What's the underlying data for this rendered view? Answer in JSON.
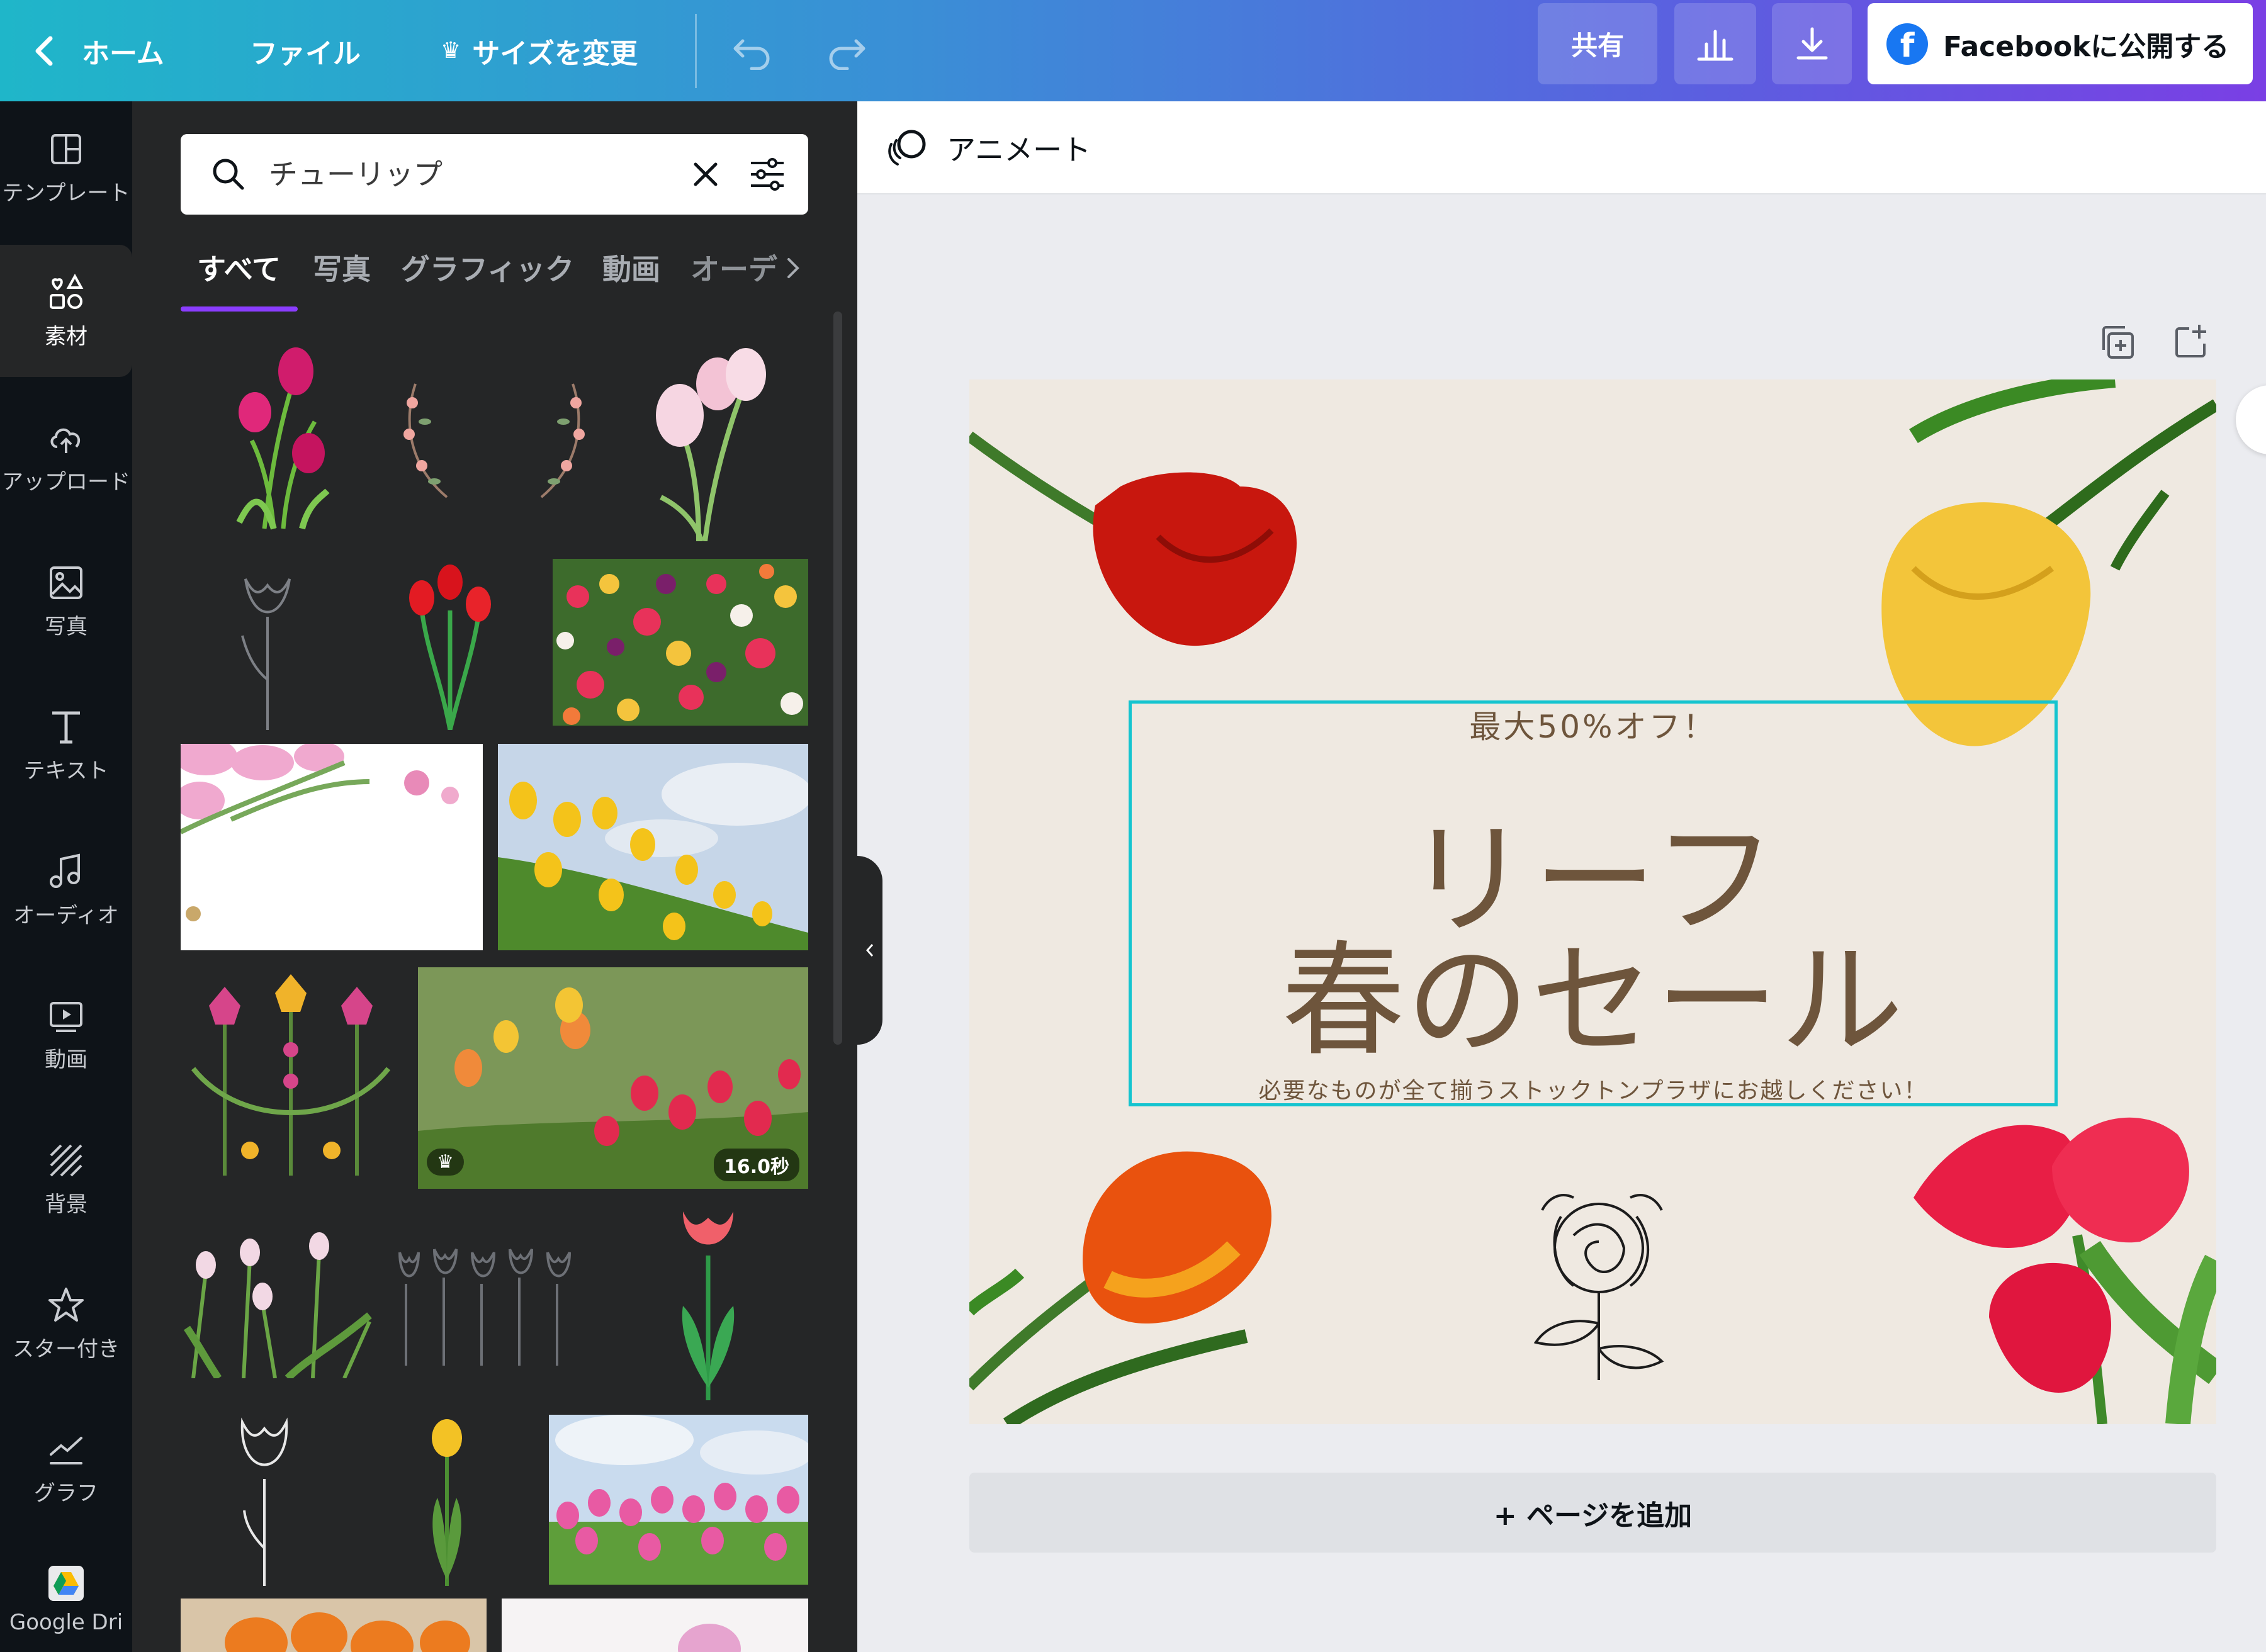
{
  "topbar": {
    "home": "ホーム",
    "file": "ファイル",
    "resize": "サイズを変更",
    "share": "共有",
    "publish": "Facebookに公開する"
  },
  "nav": {
    "templates": "テンプレート",
    "elements": "素材",
    "uploads": "アップロード",
    "photos": "写真",
    "text": "テキスト",
    "audio": "オーディオ",
    "video": "動画",
    "background": "背景",
    "starred": "スター付き",
    "chart": "グラフ",
    "gdrive": "Google Dri"
  },
  "search": {
    "value": "チューリップ"
  },
  "tabs": {
    "all": "すべて",
    "photos": "写真",
    "graphics": "グラフィック",
    "video": "動画",
    "audio": "オーデ"
  },
  "results": {
    "video_duration": "16.0秒"
  },
  "canvas": {
    "animate": "アニメート",
    "small": "最大50%オフ！",
    "title_line1": "リーフ",
    "title_line2": "春のセール",
    "footer": "必要なものが全て揃うストックトンプラザにお越しください！",
    "add_page": "+ ページを追加"
  },
  "colors": {
    "accent": "#8b3dff",
    "selection": "#14c4cf",
    "design_bg": "#efe9e1",
    "design_text": "#6e553c"
  }
}
